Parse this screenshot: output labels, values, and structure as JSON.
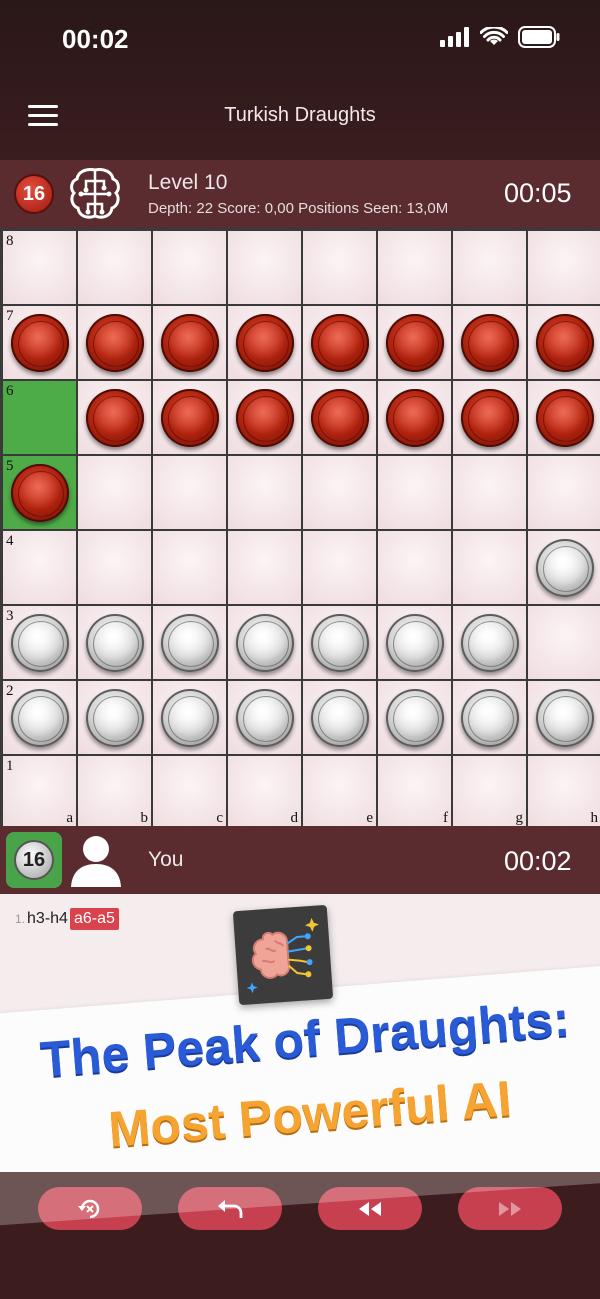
{
  "status_bar": {
    "time": "00:02",
    "icons": [
      "signal-icon",
      "wifi-icon",
      "battery-icon"
    ]
  },
  "nav": {
    "title": "Turkish Draughts",
    "menu_icon": "hamburger-menu-icon"
  },
  "ai_player": {
    "pieces_left": "16",
    "icon": "brain-circuit-icon",
    "level": "Level 10",
    "stats": "Depth: 22 Score: 0,00 Positions Seen: 13,0M",
    "clock": "00:05"
  },
  "human_player": {
    "pieces_left": "16",
    "icon": "user-avatar-icon",
    "name": "You",
    "clock": "00:02"
  },
  "board": {
    "files": [
      "a",
      "b",
      "c",
      "d",
      "e",
      "f",
      "g",
      "h"
    ],
    "ranks": [
      "8",
      "7",
      "6",
      "5",
      "4",
      "3",
      "2",
      "1"
    ],
    "rows": [
      "........",
      "rrrrrrrr",
      ".rrrrrrr",
      "r.......",
      ".......w",
      "wwwwwww.",
      "wwwwwwww",
      "........"
    ],
    "highlighted_squares": [
      "a6",
      "a5"
    ],
    "colors": {
      "red_piece": "#b2240f",
      "white_piece": "#d4d4d4",
      "highlight": "#4eac48"
    }
  },
  "move_list": {
    "number": "1.",
    "white_move": "h3-h4",
    "black_move": "a6-a5"
  },
  "promo": {
    "line1": "The Peak of Draughts:",
    "line2": "Most Powerful AI",
    "logo_icon": "ai-brain-logo-icon"
  },
  "toolbar": {
    "buttons": [
      "flip-board-icon",
      "undo-icon",
      "rewind-icon",
      "fast-forward-icon"
    ]
  }
}
